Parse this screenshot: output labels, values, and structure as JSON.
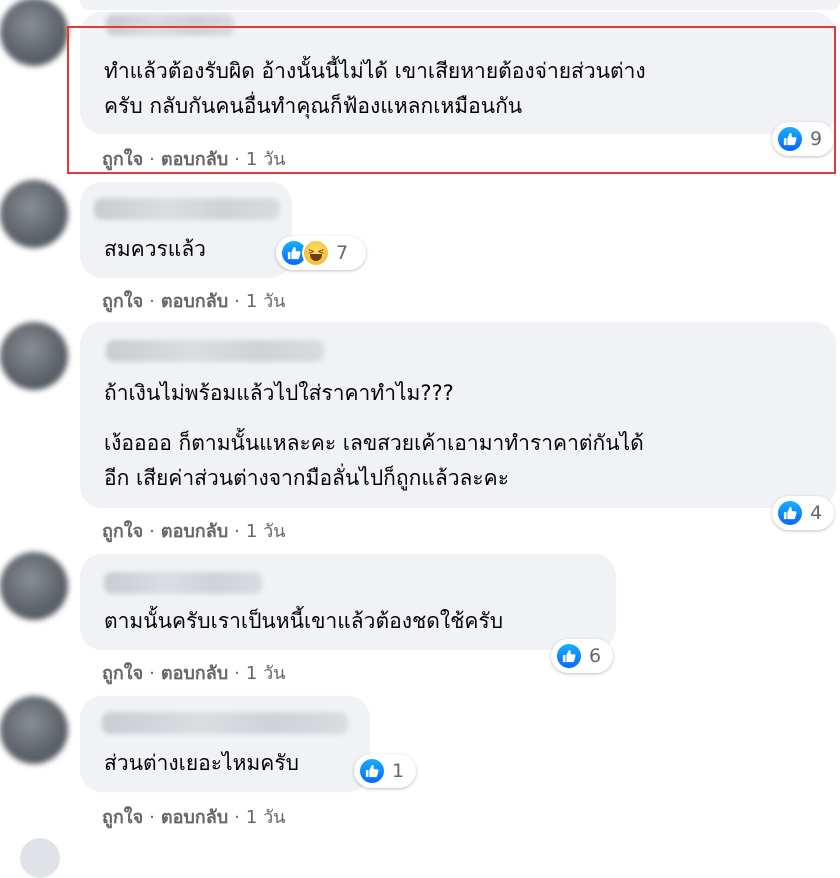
{
  "meta_labels": {
    "like": "ถูกใจ",
    "reply": "ตอบกลับ",
    "sep": "·"
  },
  "comments": [
    {
      "lines": [
        "ทำแล้วต้องรับผิด อ้างนั้นนี้ไม่ได้ เขาเสียหายต้องจ่ายส่วนต่าง",
        "ครับ กลับกันคนอื่นทำคุณก็ฟ้องแหลกเหมือนกัน"
      ],
      "reactions": [
        "like"
      ],
      "count": "9",
      "time": "1 วัน",
      "highlighted": true
    },
    {
      "lines": [
        "สมควรแล้ว"
      ],
      "reactions": [
        "like",
        "haha"
      ],
      "count": "7",
      "time": "1 วัน"
    },
    {
      "lines": [
        "ถ้าเงินไม่พร้อมแล้วไปใส่ราคาทำไม???",
        "เง้ออออ ก็ตามนั้นแหละคะ เลขสวยเค้าเอามาทำราคาต่กันได้",
        "อีก เสียค่าส่วนต่างจากมือลั่นไปก็ถูกแล้วละคะ"
      ],
      "reactions": [
        "like"
      ],
      "count": "4",
      "time": "1 วัน"
    },
    {
      "lines": [
        "ตามนั้นครับเราเป็นหนี้เขาแล้วต้องชดใช้ครับ"
      ],
      "reactions": [
        "like"
      ],
      "count": "6",
      "time": "1 วัน"
    },
    {
      "lines": [
        "ส่วนต่างเยอะไหมครับ"
      ],
      "reactions": [
        "like"
      ],
      "count": "1",
      "time": "1 วัน"
    }
  ],
  "colors": {
    "bubble": "#f0f2f5",
    "meta_text": "#65676b",
    "like_blue": "#0866ff",
    "highlight_border": "#e53935"
  },
  "icons": [
    "like-icon",
    "haha-icon",
    "avatar"
  ]
}
